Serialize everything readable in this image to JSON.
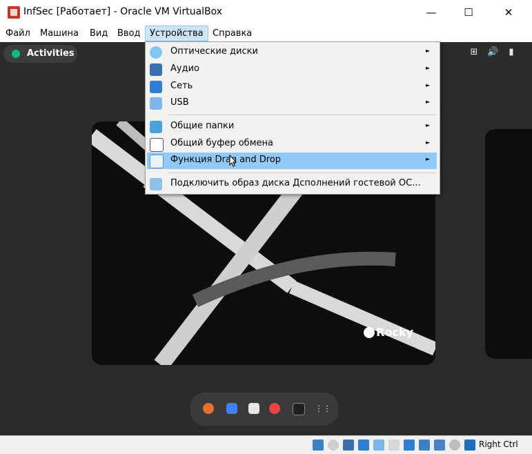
{
  "window": {
    "title": "InfSec [Работает] - Oracle VM VirtualBox",
    "minimize": "—",
    "maximize": "☐",
    "close": "✕"
  },
  "menubar": {
    "items": [
      {
        "label": "Файл"
      },
      {
        "label": "Машина"
      },
      {
        "label": "Вид"
      },
      {
        "label": "Ввод"
      },
      {
        "label": "Устройства"
      },
      {
        "label": "Справка"
      }
    ]
  },
  "devices_menu": {
    "items": [
      {
        "label": "Оптические диски",
        "icon": "optical-disc-icon",
        "submenu": true
      },
      {
        "label": "Аудио",
        "icon": "audio-icon",
        "submenu": true
      },
      {
        "label": "Сеть",
        "icon": "network-icon",
        "submenu": true
      },
      {
        "label": "USB",
        "icon": "usb-icon",
        "submenu": true
      },
      {
        "label": "Общие папки",
        "icon": "shared-folder-icon",
        "submenu": true
      },
      {
        "label": "Общий буфер обмена",
        "icon": "clipboard-icon",
        "submenu": true
      },
      {
        "label": "Функция Drag and Drop",
        "icon": "drag-drop-icon",
        "submenu": true,
        "highlighted": true
      },
      {
        "label": "Подключить образ диска Дсполнений гостевой ОС...",
        "icon": "guest-additions-icon",
        "submenu": false
      }
    ],
    "arrow": "►"
  },
  "guest": {
    "activities_label": "Activities",
    "tray": {
      "network": "⊞",
      "volume": "🔊",
      "battery": "▮"
    },
    "wallpaper_logo": "Rocky",
    "dock_apps": [
      "firefox-icon",
      "text-editor-icon",
      "software-icon",
      "help-icon",
      "terminal-icon",
      "app-grid-icon"
    ]
  },
  "statusbar": {
    "host_key": "Right Ctrl"
  },
  "colors": {
    "menu_highlight": "#91c9f7",
    "menubar_active": "#cce4f7",
    "vm_background": "#2b2b2b",
    "rocky_green": "#10b981"
  }
}
